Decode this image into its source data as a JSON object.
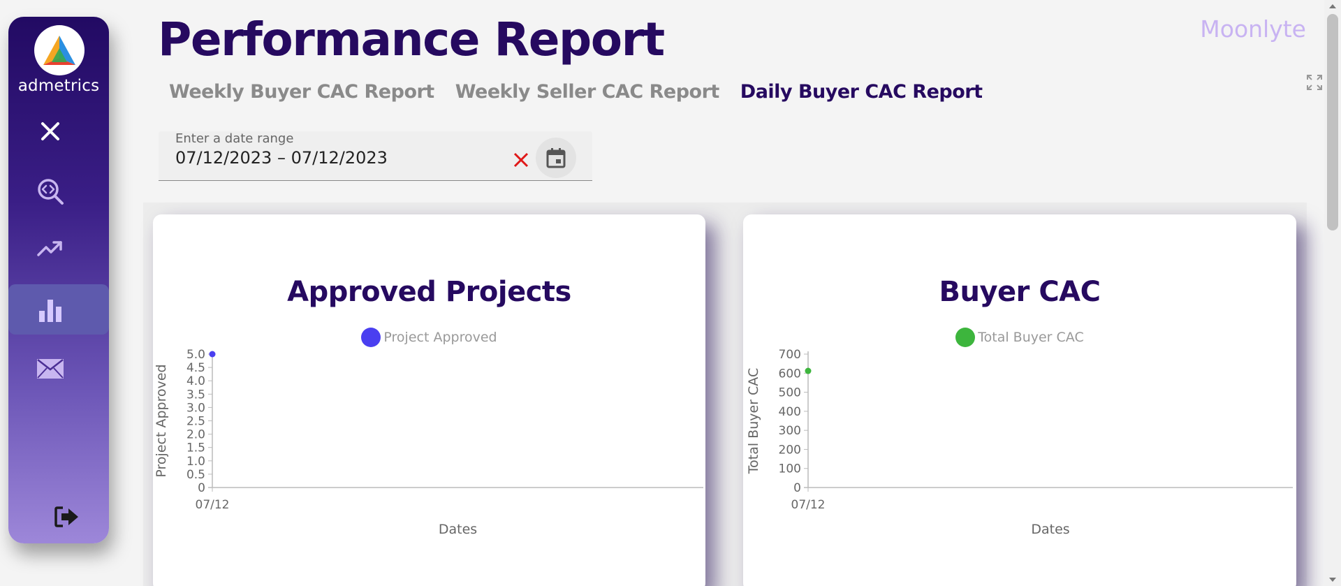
{
  "sidebar": {
    "brand": "admetrics",
    "items": [
      {
        "name": "close",
        "icon": "close-icon"
      },
      {
        "name": "code-search",
        "icon": "code-search-icon"
      },
      {
        "name": "trending",
        "icon": "trending-up-icon"
      },
      {
        "name": "bar-chart",
        "icon": "bar-chart-icon",
        "active": true
      },
      {
        "name": "mail",
        "icon": "mail-icon"
      },
      {
        "name": "logout",
        "icon": "logout-icon"
      }
    ]
  },
  "header": {
    "title": "Performance Report",
    "brand": "Moonlyte",
    "tabs": [
      {
        "label": "Weekly Buyer CAC Report"
      },
      {
        "label": "Weekly Seller CAC Report"
      },
      {
        "label": "Daily Buyer CAC Report",
        "active": true
      }
    ]
  },
  "date_range": {
    "label": "Enter a date range",
    "value": "07/12/2023 – 07/12/2023"
  },
  "colors": {
    "accent": "#260a60",
    "clear": "#e01818",
    "series1": "#4a3ff0",
    "series2": "#3db53d"
  },
  "chart_data": [
    {
      "type": "scatter",
      "title": "Approved Projects",
      "xlabel": "Dates",
      "ylabel": "Project Approved",
      "categories": [
        "07/12"
      ],
      "ylim": [
        0,
        5
      ],
      "yticks": [
        "0",
        "0.5",
        "1.0",
        "1.5",
        "2.0",
        "2.5",
        "3.0",
        "3.5",
        "4.0",
        "4.5",
        "5.0"
      ],
      "series": [
        {
          "name": "Project Approved",
          "values": [
            5
          ],
          "color": "#4a3ff0"
        }
      ],
      "legend": "top-center"
    },
    {
      "type": "scatter",
      "title": "Buyer CAC",
      "xlabel": "Dates",
      "ylabel": "Total Buyer CAC",
      "categories": [
        "07/12"
      ],
      "ylim": [
        0,
        700
      ],
      "yticks": [
        "0",
        "100",
        "200",
        "300",
        "400",
        "500",
        "600",
        "700"
      ],
      "series": [
        {
          "name": "Total Buyer CAC",
          "values": [
            612
          ],
          "color": "#3db53d"
        }
      ],
      "legend": "top-center"
    }
  ]
}
